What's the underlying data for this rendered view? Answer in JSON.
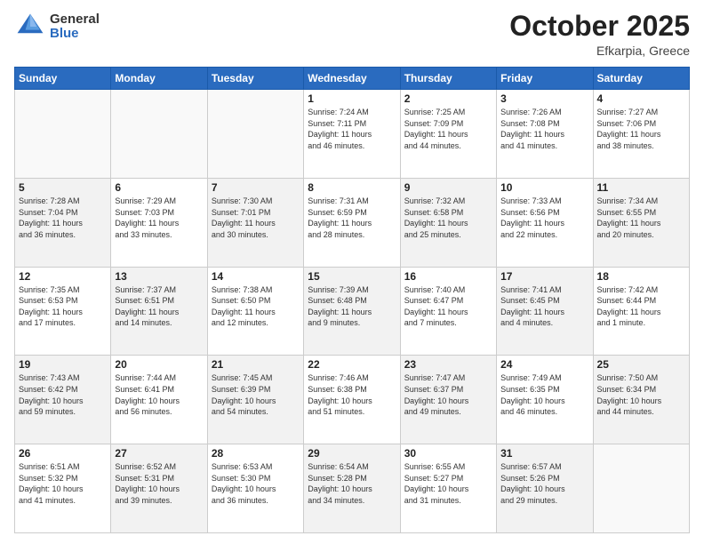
{
  "logo": {
    "general": "General",
    "blue": "Blue"
  },
  "title": {
    "month": "October 2025",
    "location": "Efkarpia, Greece"
  },
  "days_header": [
    "Sunday",
    "Monday",
    "Tuesday",
    "Wednesday",
    "Thursday",
    "Friday",
    "Saturday"
  ],
  "weeks": [
    [
      {
        "day": "",
        "info": "",
        "shaded": true
      },
      {
        "day": "",
        "info": "",
        "shaded": true
      },
      {
        "day": "",
        "info": "",
        "shaded": true
      },
      {
        "day": "1",
        "info": "Sunrise: 7:24 AM\nSunset: 7:11 PM\nDaylight: 11 hours\nand 46 minutes.",
        "shaded": false
      },
      {
        "day": "2",
        "info": "Sunrise: 7:25 AM\nSunset: 7:09 PM\nDaylight: 11 hours\nand 44 minutes.",
        "shaded": false
      },
      {
        "day": "3",
        "info": "Sunrise: 7:26 AM\nSunset: 7:08 PM\nDaylight: 11 hours\nand 41 minutes.",
        "shaded": false
      },
      {
        "day": "4",
        "info": "Sunrise: 7:27 AM\nSunset: 7:06 PM\nDaylight: 11 hours\nand 38 minutes.",
        "shaded": false
      }
    ],
    [
      {
        "day": "5",
        "info": "Sunrise: 7:28 AM\nSunset: 7:04 PM\nDaylight: 11 hours\nand 36 minutes.",
        "shaded": true
      },
      {
        "day": "6",
        "info": "Sunrise: 7:29 AM\nSunset: 7:03 PM\nDaylight: 11 hours\nand 33 minutes.",
        "shaded": false
      },
      {
        "day": "7",
        "info": "Sunrise: 7:30 AM\nSunset: 7:01 PM\nDaylight: 11 hours\nand 30 minutes.",
        "shaded": true
      },
      {
        "day": "8",
        "info": "Sunrise: 7:31 AM\nSunset: 6:59 PM\nDaylight: 11 hours\nand 28 minutes.",
        "shaded": false
      },
      {
        "day": "9",
        "info": "Sunrise: 7:32 AM\nSunset: 6:58 PM\nDaylight: 11 hours\nand 25 minutes.",
        "shaded": true
      },
      {
        "day": "10",
        "info": "Sunrise: 7:33 AM\nSunset: 6:56 PM\nDaylight: 11 hours\nand 22 minutes.",
        "shaded": false
      },
      {
        "day": "11",
        "info": "Sunrise: 7:34 AM\nSunset: 6:55 PM\nDaylight: 11 hours\nand 20 minutes.",
        "shaded": true
      }
    ],
    [
      {
        "day": "12",
        "info": "Sunrise: 7:35 AM\nSunset: 6:53 PM\nDaylight: 11 hours\nand 17 minutes.",
        "shaded": false
      },
      {
        "day": "13",
        "info": "Sunrise: 7:37 AM\nSunset: 6:51 PM\nDaylight: 11 hours\nand 14 minutes.",
        "shaded": true
      },
      {
        "day": "14",
        "info": "Sunrise: 7:38 AM\nSunset: 6:50 PM\nDaylight: 11 hours\nand 12 minutes.",
        "shaded": false
      },
      {
        "day": "15",
        "info": "Sunrise: 7:39 AM\nSunset: 6:48 PM\nDaylight: 11 hours\nand 9 minutes.",
        "shaded": true
      },
      {
        "day": "16",
        "info": "Sunrise: 7:40 AM\nSunset: 6:47 PM\nDaylight: 11 hours\nand 7 minutes.",
        "shaded": false
      },
      {
        "day": "17",
        "info": "Sunrise: 7:41 AM\nSunset: 6:45 PM\nDaylight: 11 hours\nand 4 minutes.",
        "shaded": true
      },
      {
        "day": "18",
        "info": "Sunrise: 7:42 AM\nSunset: 6:44 PM\nDaylight: 11 hours\nand 1 minute.",
        "shaded": false
      }
    ],
    [
      {
        "day": "19",
        "info": "Sunrise: 7:43 AM\nSunset: 6:42 PM\nDaylight: 10 hours\nand 59 minutes.",
        "shaded": true
      },
      {
        "day": "20",
        "info": "Sunrise: 7:44 AM\nSunset: 6:41 PM\nDaylight: 10 hours\nand 56 minutes.",
        "shaded": false
      },
      {
        "day": "21",
        "info": "Sunrise: 7:45 AM\nSunset: 6:39 PM\nDaylight: 10 hours\nand 54 minutes.",
        "shaded": true
      },
      {
        "day": "22",
        "info": "Sunrise: 7:46 AM\nSunset: 6:38 PM\nDaylight: 10 hours\nand 51 minutes.",
        "shaded": false
      },
      {
        "day": "23",
        "info": "Sunrise: 7:47 AM\nSunset: 6:37 PM\nDaylight: 10 hours\nand 49 minutes.",
        "shaded": true
      },
      {
        "day": "24",
        "info": "Sunrise: 7:49 AM\nSunset: 6:35 PM\nDaylight: 10 hours\nand 46 minutes.",
        "shaded": false
      },
      {
        "day": "25",
        "info": "Sunrise: 7:50 AM\nSunset: 6:34 PM\nDaylight: 10 hours\nand 44 minutes.",
        "shaded": true
      }
    ],
    [
      {
        "day": "26",
        "info": "Sunrise: 6:51 AM\nSunset: 5:32 PM\nDaylight: 10 hours\nand 41 minutes.",
        "shaded": false
      },
      {
        "day": "27",
        "info": "Sunrise: 6:52 AM\nSunset: 5:31 PM\nDaylight: 10 hours\nand 39 minutes.",
        "shaded": true
      },
      {
        "day": "28",
        "info": "Sunrise: 6:53 AM\nSunset: 5:30 PM\nDaylight: 10 hours\nand 36 minutes.",
        "shaded": false
      },
      {
        "day": "29",
        "info": "Sunrise: 6:54 AM\nSunset: 5:28 PM\nDaylight: 10 hours\nand 34 minutes.",
        "shaded": true
      },
      {
        "day": "30",
        "info": "Sunrise: 6:55 AM\nSunset: 5:27 PM\nDaylight: 10 hours\nand 31 minutes.",
        "shaded": false
      },
      {
        "day": "31",
        "info": "Sunrise: 6:57 AM\nSunset: 5:26 PM\nDaylight: 10 hours\nand 29 minutes.",
        "shaded": true
      },
      {
        "day": "",
        "info": "",
        "shaded": false
      }
    ]
  ]
}
